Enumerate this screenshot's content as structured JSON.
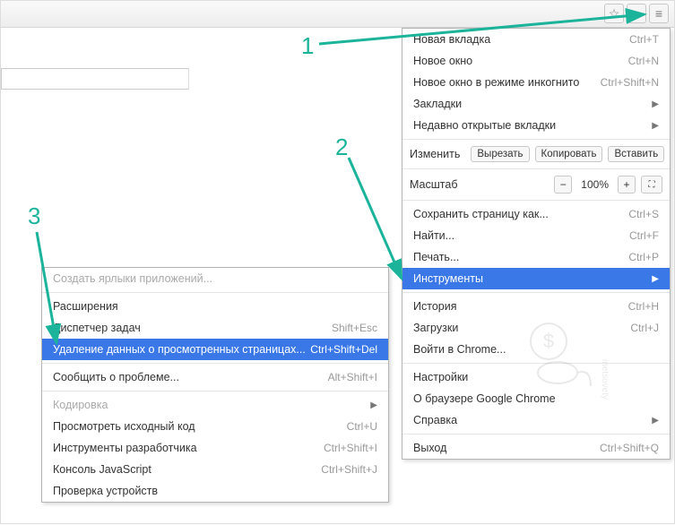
{
  "annotations": {
    "n1": "1",
    "n2": "2",
    "n3": "3"
  },
  "main_menu": {
    "new_tab": {
      "label": "Новая вкладка",
      "sc": "Ctrl+T"
    },
    "new_window": {
      "label": "Новое окно",
      "sc": "Ctrl+N"
    },
    "incognito": {
      "label": "Новое окно в режиме инкогнито",
      "sc": "Ctrl+Shift+N"
    },
    "bookmarks": {
      "label": "Закладки"
    },
    "recent": {
      "label": "Недавно открытые вкладки"
    },
    "edit_label": "Изменить",
    "cut": "Вырезать",
    "copy": "Копировать",
    "paste": "Вставить",
    "zoom_label": "Масштаб",
    "zoom_value": "100%",
    "save_as": {
      "label": "Сохранить страницу как...",
      "sc": "Ctrl+S"
    },
    "find": {
      "label": "Найти...",
      "sc": "Ctrl+F"
    },
    "print": {
      "label": "Печать...",
      "sc": "Ctrl+P"
    },
    "tools": {
      "label": "Инструменты"
    },
    "history": {
      "label": "История",
      "sc": "Ctrl+H"
    },
    "downloads": {
      "label": "Загрузки",
      "sc": "Ctrl+J"
    },
    "signin": {
      "label": "Войти в Chrome..."
    },
    "settings": {
      "label": "Настройки"
    },
    "about": {
      "label": "О браузере Google Chrome"
    },
    "help": {
      "label": "Справка"
    },
    "exit": {
      "label": "Выход",
      "sc": "Ctrl+Shift+Q"
    }
  },
  "sub_menu": {
    "create_shortcuts": {
      "label": "Создать ярлыки приложений..."
    },
    "extensions": {
      "label": "Расширения"
    },
    "task_manager": {
      "label": "Диспетчер задач",
      "sc": "Shift+Esc"
    },
    "clear_data": {
      "label": "Удаление данных о просмотренных страницах...",
      "sc": "Ctrl+Shift+Del"
    },
    "report": {
      "label": "Сообщить о проблеме...",
      "sc": "Alt+Shift+I"
    },
    "encoding": {
      "label": "Кодировка"
    },
    "view_source": {
      "label": "Просмотреть исходный код",
      "sc": "Ctrl+U"
    },
    "dev_tools": {
      "label": "Инструменты разработчика",
      "sc": "Ctrl+Shift+I"
    },
    "js_console": {
      "label": "Консоль JavaScript",
      "sc": "Ctrl+Shift+J"
    },
    "inspect_devices": {
      "label": "Проверка устройств"
    }
  },
  "watermark": "inetsovety.ru"
}
